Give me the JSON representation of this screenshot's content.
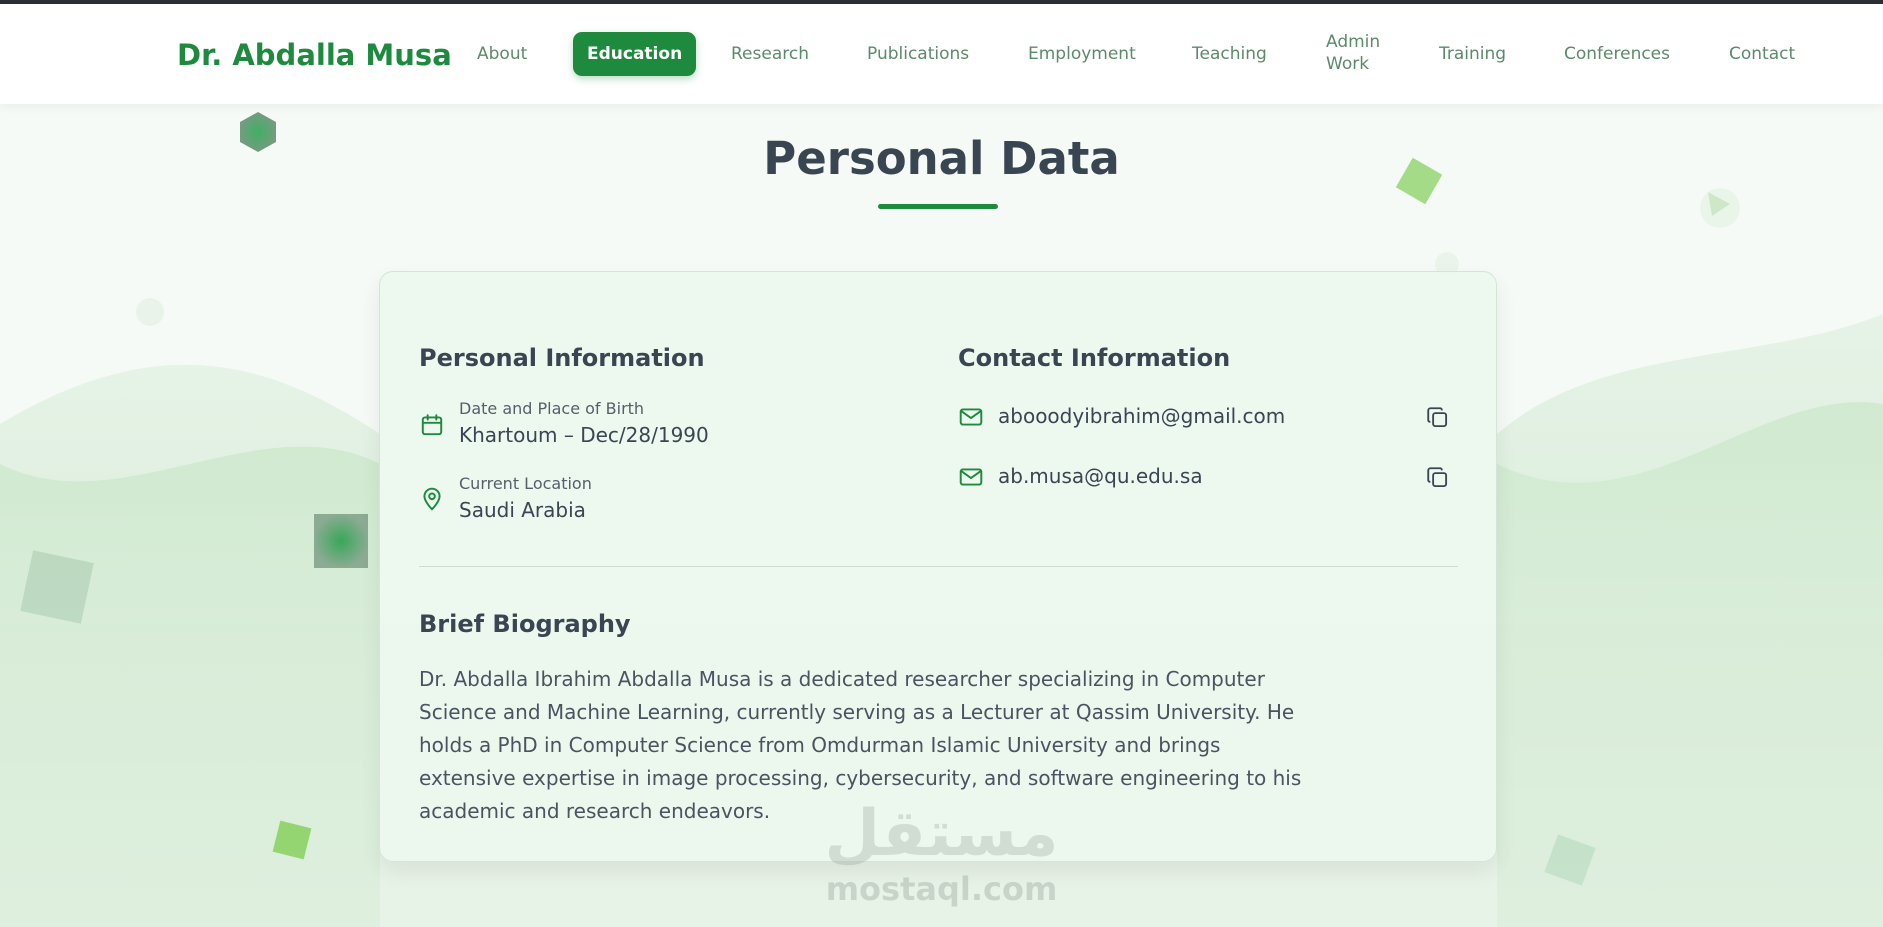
{
  "brand": "Dr. Abdalla Musa",
  "nav": {
    "items": [
      "About",
      "Education",
      "Research",
      "Publications",
      "Employment",
      "Teaching",
      "Admin Work",
      "Training",
      "Conferences",
      "Contact"
    ],
    "admin_line1": "Admin",
    "admin_line2": "Work",
    "active": "Education"
  },
  "page_title": "Personal Data",
  "personal": {
    "heading": "Personal Information",
    "birth_label": "Date and Place of Birth",
    "birth_value": "Khartoum – Dec/28/1990",
    "location_label": "Current Location",
    "location_value": "Saudi Arabia",
    "birth_icon": "calendar-icon",
    "location_icon": "location-pin-icon"
  },
  "contact": {
    "heading": "Contact Information",
    "emails": [
      "abooodyibrahim@gmail.com",
      "ab.musa@qu.edu.sa"
    ],
    "email_icon": "mail-icon",
    "copy_icon": "copy-icon"
  },
  "bio": {
    "heading": "Brief Biography",
    "text": "Dr. Abdalla Ibrahim Abdalla Musa is a dedicated researcher specializing in Computer Science and Machine Learning, currently serving as a Lecturer at Qassim University. He holds a PhD in Computer Science from Omdurman Islamic University and brings extensive expertise in image processing, cybersecurity, and software engineering to his academic and research endeavors."
  },
  "watermark": {
    "arabic": "مستقل",
    "latin": "mostaql.com"
  },
  "colors": {
    "accent": "#1e8a3e",
    "nav_text": "#5b8a6a",
    "heading": "#3a4552"
  }
}
